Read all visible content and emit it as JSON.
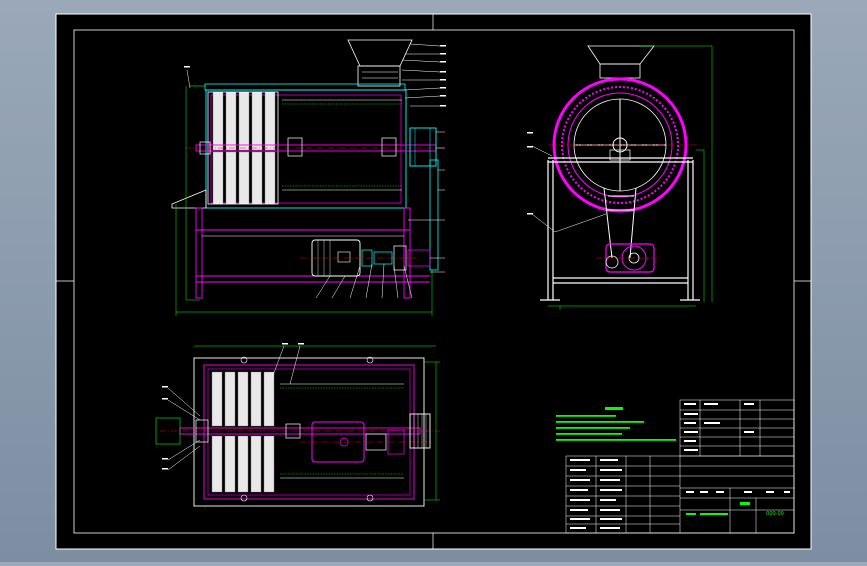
{
  "drawing": {
    "colors": {
      "background": "#000000",
      "frame": "#ffffff",
      "casing": "#00ffff",
      "structure": "#ff00ff",
      "dimension": "#00ff00",
      "center_line": "#ff0000",
      "leader": "#ffffff",
      "body_fill": "#ffffff"
    }
  },
  "title_block": {
    "stamp_text": "000-00"
  }
}
